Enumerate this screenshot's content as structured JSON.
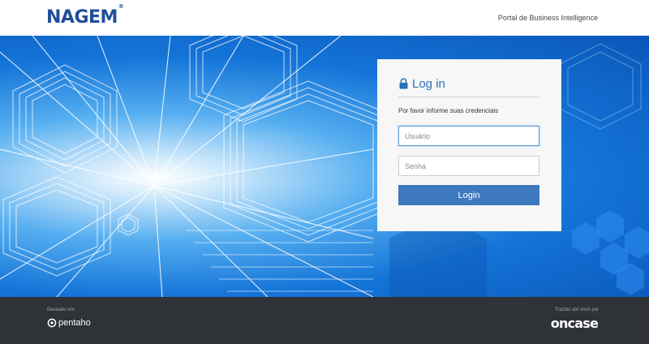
{
  "header": {
    "logo_text": "NAGEM",
    "logo_mark": "®",
    "portal_title": "Portal de Business Intelligence"
  },
  "login": {
    "title": "Log in",
    "title_icon": "lock-icon",
    "subtitle": "Por favor informe suas credenciais",
    "username_placeholder": "Usuário",
    "username_value": "",
    "password_placeholder": "Senha",
    "password_value": "",
    "button_label": "Login"
  },
  "footer": {
    "left_label": "Baseado em",
    "left_brand": "pentaho",
    "right_label": "Trazido até você por",
    "right_brand": "oncase"
  },
  "colors": {
    "brand_blue": "#1f4e9c",
    "accent": "#3e78be",
    "footer_bg": "#2f3338",
    "hero_blue": "#1474d8"
  }
}
